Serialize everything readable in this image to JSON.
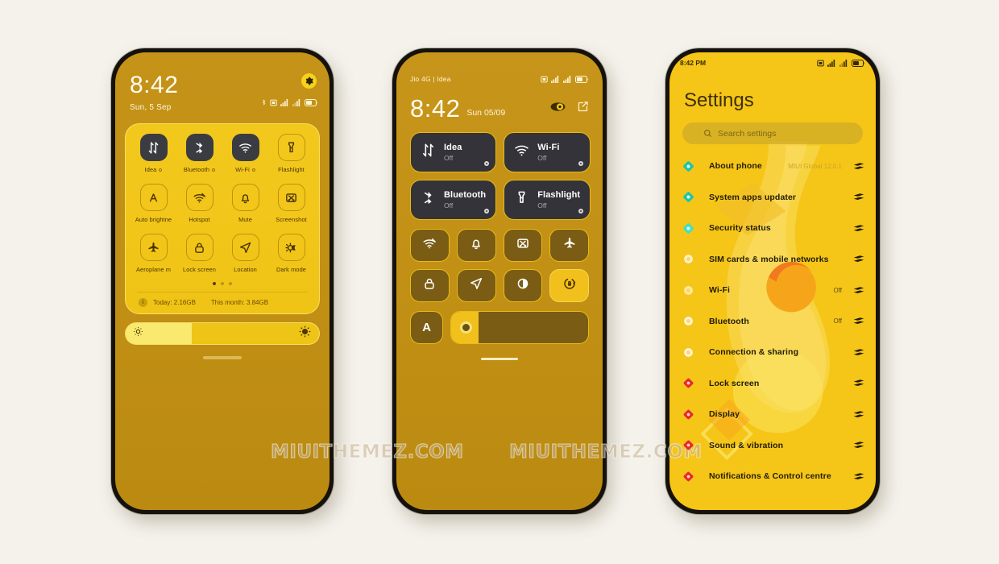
{
  "watermark": "MIUITHEMEZ.COM",
  "colors": {
    "page_background": "#f5f2ec",
    "shade_gold": "#c0900f",
    "tile_card_yellow": "#f1c617",
    "settings_yellow": "#f5c518",
    "tile_active_dark": "#3b3c42",
    "accent_selected": "#f2c01c"
  },
  "phone1": {
    "name": "notification-shade",
    "clock": "8:42",
    "date": "Sun, 5 Sep",
    "gear_icon": "gear-icon",
    "status_icons": [
      "bluetooth-icon",
      "vpn-icon",
      "signal-bars-icon",
      "signal-bars-roaming-icon",
      "battery-icon"
    ],
    "battery_level": "48",
    "tiles": [
      {
        "label": "Idea",
        "icon": "data-arrows-icon",
        "active": true,
        "has_dot": true
      },
      {
        "label": "Bluetooth",
        "icon": "bluetooth-icon",
        "active": true,
        "has_dot": true
      },
      {
        "label": "Wi-Fi",
        "icon": "wifi-icon",
        "active": true,
        "has_dot": true
      },
      {
        "label": "Flashlight",
        "icon": "flashlight-icon",
        "active": false,
        "has_dot": false
      },
      {
        "label": "Auto brightne",
        "icon": "auto-brightness-icon",
        "active": false,
        "has_dot": false
      },
      {
        "label": "Hotspot",
        "icon": "hotspot-icon",
        "active": false,
        "has_dot": false
      },
      {
        "label": "Mute",
        "icon": "bell-icon",
        "active": false,
        "has_dot": false
      },
      {
        "label": "Screenshot",
        "icon": "screenshot-icon",
        "active": false,
        "has_dot": false
      },
      {
        "label": "Aeroplane m",
        "icon": "aeroplane-icon",
        "active": false,
        "has_dot": false
      },
      {
        "label": "Lock screen",
        "icon": "lock-icon",
        "active": false,
        "has_dot": false
      },
      {
        "label": "Location",
        "icon": "location-arrow-icon",
        "active": false,
        "has_dot": false
      },
      {
        "label": "Dark mode",
        "icon": "dark-mode-icon",
        "active": false,
        "has_dot": false
      }
    ],
    "page_dots": {
      "count": 3,
      "active_index": 0
    },
    "data_usage": {
      "badge": "i",
      "today": "Today: 2.16GB",
      "month": "This month: 3.84GB"
    },
    "brightness": {
      "icon_left": "brightness-low-icon",
      "icon_right": "brightness-high-icon",
      "percent": 34
    }
  },
  "phone2": {
    "name": "control-centre",
    "carrier": "Jio 4G | Idea",
    "status_icons": [
      "vpn-icon",
      "signal-bars-icon",
      "signal-bars-icon",
      "battery-icon"
    ],
    "battery_level": "48",
    "time": "8:42",
    "date": "Sun 05/09",
    "actions": [
      "power-eye-icon",
      "edit-icon"
    ],
    "big_tiles": [
      {
        "name": "Idea",
        "state": "Off",
        "icon": "data-arrows-icon"
      },
      {
        "name": "Wi-Fi",
        "state": "Off",
        "icon": "wifi-icon"
      },
      {
        "name": "Bluetooth",
        "state": "Off",
        "icon": "bluetooth-icon"
      },
      {
        "name": "Flashlight",
        "state": "Off",
        "icon": "flashlight-icon"
      }
    ],
    "small_tiles": [
      {
        "icon": "hotspot-icon",
        "selected": false
      },
      {
        "icon": "bell-icon",
        "selected": false
      },
      {
        "icon": "screenshot-icon",
        "selected": false
      },
      {
        "icon": "aeroplane-icon",
        "selected": false
      },
      {
        "icon": "lock-icon",
        "selected": false
      },
      {
        "icon": "location-arrow-icon",
        "selected": false
      },
      {
        "icon": "dark-mode-contrast-icon",
        "selected": false
      },
      {
        "icon": "auto-rotate-icon",
        "selected": true
      }
    ],
    "bottom_row": {
      "auto_label": "A",
      "slider_percent": 20,
      "slider_icon": "brightness-knob-icon"
    }
  },
  "phone3": {
    "name": "settings",
    "status_time": "8:42 PM",
    "status_icons": [
      "vpn-icon",
      "signal-bars-icon",
      "signal-bars-roaming-icon",
      "battery-icon"
    ],
    "battery_level": "48",
    "title": "Settings",
    "search": {
      "icon": "search-icon",
      "placeholder": "Search settings"
    },
    "items": [
      {
        "label": "About phone",
        "value": "MIUI Global 12.0.1",
        "value_ghost": true,
        "icon": "about-phone-icon",
        "icon_color": "#18c7a8"
      },
      {
        "label": "System apps updater",
        "value": "",
        "value_ghost": false,
        "icon": "system-updater-icon",
        "icon_color": "#18c7a8"
      },
      {
        "label": "Security status",
        "value": "",
        "value_ghost": false,
        "icon": "security-status-icon",
        "icon_color": "#3de0c4"
      },
      {
        "label": "SIM cards & mobile networks",
        "value": "",
        "value_ghost": false,
        "icon": "sim-card-icon",
        "icon_color": "#fff0cf"
      },
      {
        "label": "Wi-Fi",
        "value": "Off",
        "value_ghost": false,
        "icon": "wifi-settings-icon",
        "icon_color": "#ffe9a8"
      },
      {
        "label": "Bluetooth",
        "value": "Off",
        "value_ghost": false,
        "icon": "bluetooth-settings-icon",
        "icon_color": "#fff4dd"
      },
      {
        "label": "Connection & sharing",
        "value": "",
        "value_ghost": false,
        "icon": "connection-sharing-icon",
        "icon_color": "#fff4dd"
      },
      {
        "label": "Lock screen",
        "value": "",
        "value_ghost": false,
        "icon": "lock-screen-icon",
        "icon_color": "#e8272f"
      },
      {
        "label": "Display",
        "value": "",
        "value_ghost": false,
        "icon": "display-icon",
        "icon_color": "#e8272f"
      },
      {
        "label": "Sound & vibration",
        "value": "",
        "value_ghost": false,
        "icon": "sound-vibration-icon",
        "icon_color": "#e8272f"
      },
      {
        "label": "Notifications & Control centre",
        "value": "",
        "value_ghost": false,
        "icon": "notifications-icon",
        "icon_color": "#e8272f"
      }
    ],
    "row_arrow_icon": "double-chevron-icon"
  }
}
